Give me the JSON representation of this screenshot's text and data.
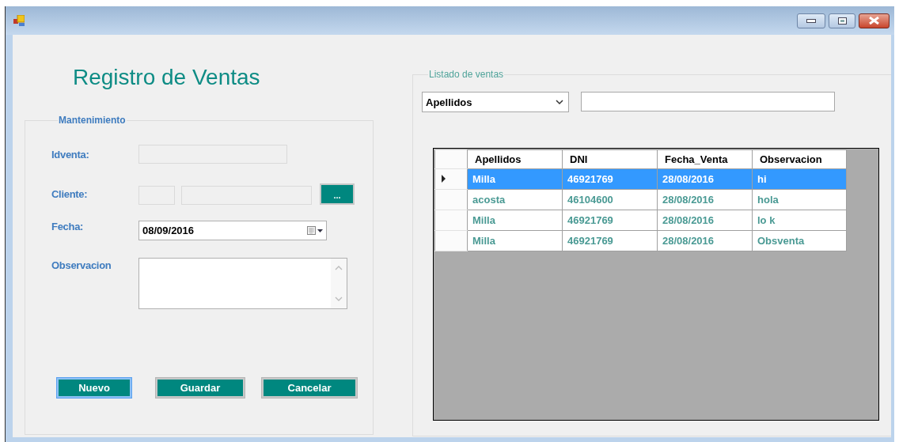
{
  "heading": "Registro de Ventas",
  "maintenance": {
    "legend": "Mantenimiento",
    "fields": [
      {
        "kind": "text",
        "label": "Idventa:"
      },
      {
        "kind": "lookup",
        "label": "Cliente:",
        "button": "..."
      },
      {
        "kind": "date",
        "label": "Fecha:",
        "value": "08/09/2016"
      },
      {
        "kind": "memo",
        "label": "Observacion"
      }
    ],
    "buttons": [
      {
        "label": "Nuevo",
        "focused": true
      },
      {
        "label": "Guardar",
        "focused": false
      },
      {
        "label": "Cancelar",
        "focused": false
      }
    ]
  },
  "listing": {
    "legend": "Listado de ventas",
    "filter_by": "Apellidos",
    "table": {
      "columns": [
        "Apellidos",
        "DNI",
        "Fecha_Venta",
        "Observacion"
      ],
      "rows": [
        {
          "selected": true,
          "current": true,
          "cells": [
            "Milla",
            "46921769",
            "28/08/2016",
            "hi"
          ]
        },
        {
          "selected": false,
          "current": false,
          "cells": [
            "acosta",
            "46104600",
            "28/08/2016",
            "hola"
          ]
        },
        {
          "selected": false,
          "current": false,
          "cells": [
            "Milla",
            "46921769",
            "28/08/2016",
            "lo k"
          ]
        },
        {
          "selected": false,
          "current": false,
          "cells": [
            "Milla",
            "46921769",
            "28/08/2016",
            "Obsventa"
          ]
        }
      ]
    }
  }
}
